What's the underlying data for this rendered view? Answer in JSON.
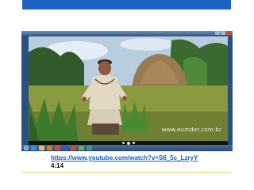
{
  "slide": {
    "link_text": "https://www.youtube.com/watch?v=S6_5c_LzryY",
    "timestamp": "4:14"
  },
  "video": {
    "watermark": "www.eumder.com.br"
  },
  "colors": {
    "top_bar": "#1e63c4",
    "link": "#1560c9",
    "rule": "#e4d25c"
  },
  "icons": {
    "taskbar": [
      "start-orb-icon",
      "ie-icon",
      "folder-icon",
      "media-player-icon",
      "chrome-icon",
      "word-icon",
      "powerpoint-icon",
      "paint-icon",
      "media-center-icon"
    ]
  }
}
